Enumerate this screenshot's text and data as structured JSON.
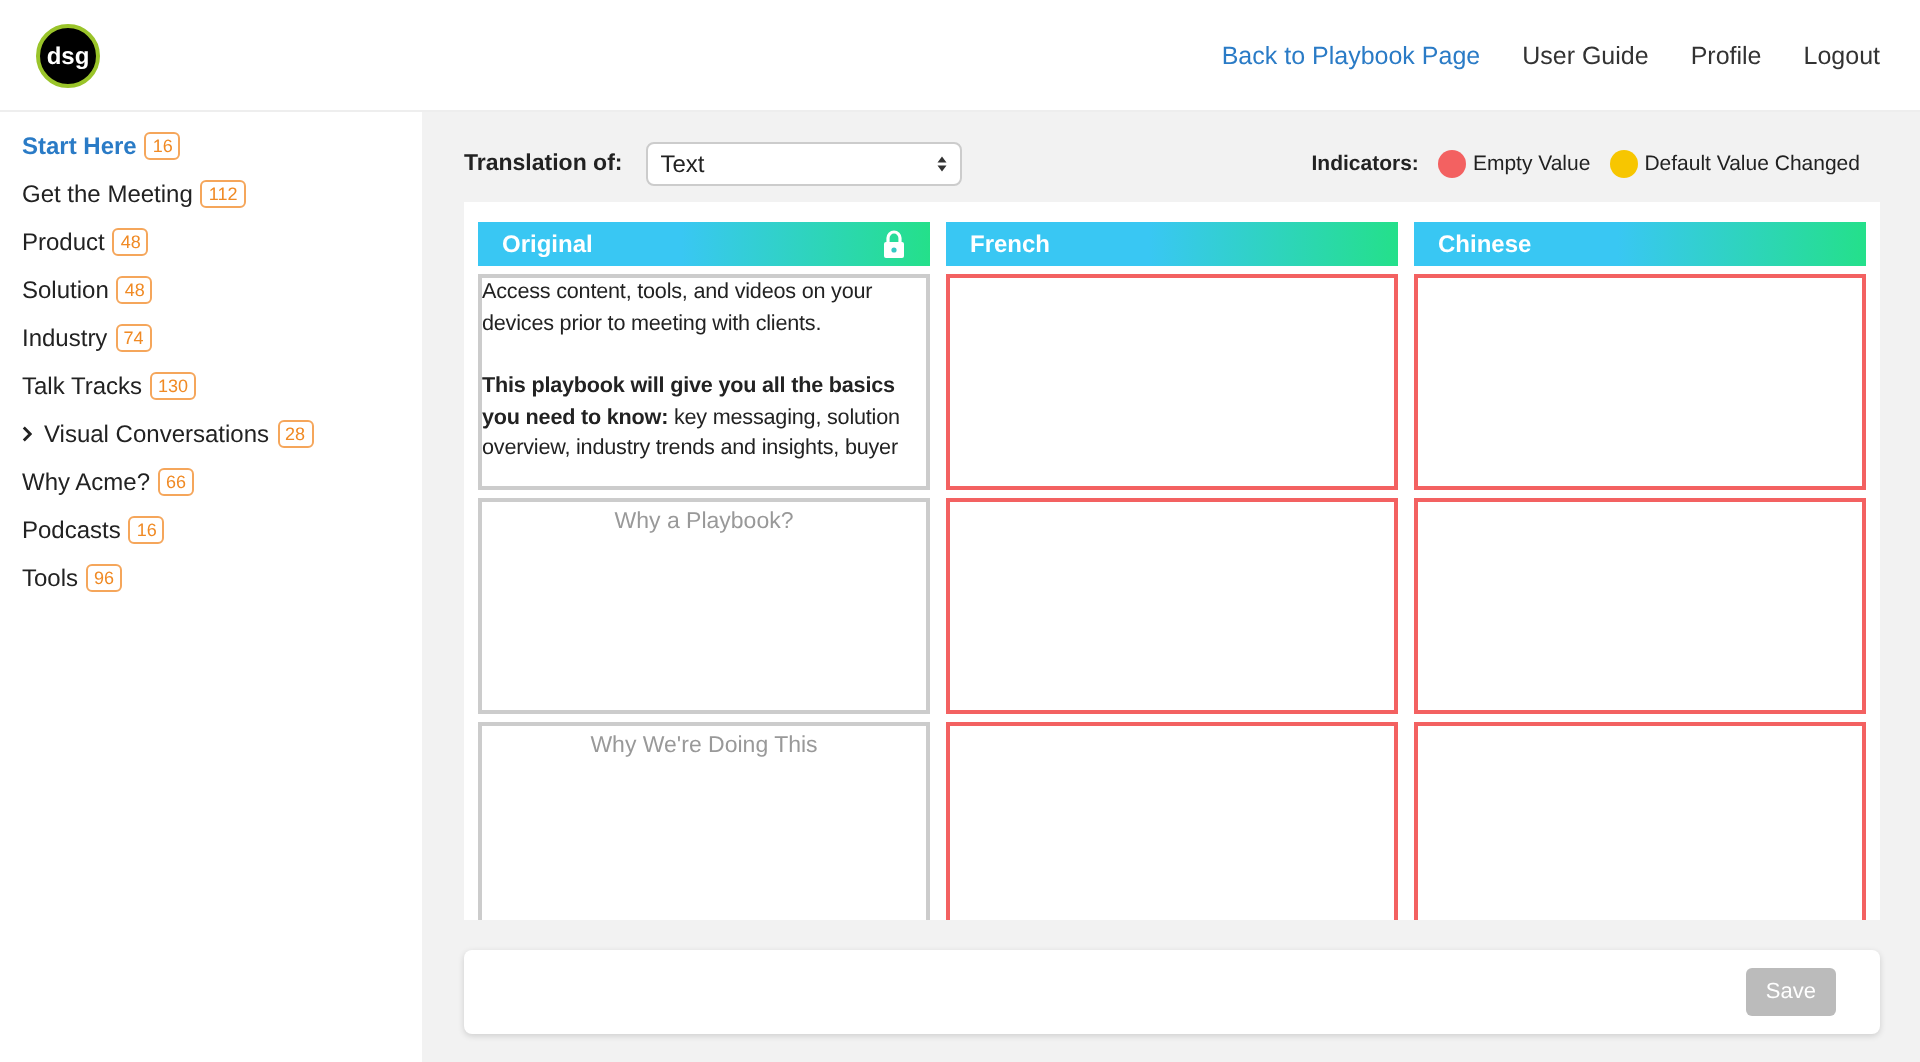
{
  "logo": {
    "text": "dsg"
  },
  "nav": [
    "Back to Playbook Page",
    "User Guide",
    "Profile",
    "Logout"
  ],
  "sidebar": {
    "items": [
      {
        "label": "Start Here",
        "count": "16",
        "selected": true,
        "collapsible": false
      },
      {
        "label": "Get the Meeting",
        "count": "112",
        "selected": false,
        "collapsible": false
      },
      {
        "label": "Product",
        "count": "48",
        "selected": false,
        "collapsible": false
      },
      {
        "label": "Solution",
        "count": "48",
        "selected": false,
        "collapsible": false
      },
      {
        "label": "Industry",
        "count": "74",
        "selected": false,
        "collapsible": false
      },
      {
        "label": "Talk Tracks",
        "count": "130",
        "selected": false,
        "collapsible": false
      },
      {
        "label": "Visual Conversations",
        "count": "28",
        "selected": false,
        "collapsible": true
      },
      {
        "label": "Why Acme?",
        "count": "66",
        "selected": false,
        "collapsible": false
      },
      {
        "label": "Podcasts",
        "count": "16",
        "selected": false,
        "collapsible": false
      },
      {
        "label": "Tools",
        "count": "96",
        "selected": false,
        "collapsible": false
      }
    ]
  },
  "translation_of": {
    "label": "Translation of:",
    "value": "Text"
  },
  "indicators": {
    "label": "Indicators:",
    "items": [
      {
        "label": "Empty Value",
        "color": "#f36161"
      },
      {
        "label": "Default Value Changed",
        "color": "#f7c600"
      }
    ]
  },
  "columns": [
    {
      "title": "Original",
      "locked": true
    },
    {
      "title": "French",
      "locked": false
    },
    {
      "title": "Chinese",
      "locked": false
    }
  ],
  "rows": [
    {
      "original": {
        "paragraphs": [
          "Access content, tools, and videos on your devices prior to meeting with clients.",
          "**This playbook will give you all the basics you need to know:** key messaging, solution overview, industry trends and insights, buyer"
        ]
      },
      "translations": [
        {
          "empty": true
        },
        {
          "empty": true
        }
      ]
    },
    {
      "original": {
        "placeholder": "Why a Playbook?"
      },
      "translations": [
        {
          "empty": true
        },
        {
          "empty": true
        }
      ]
    },
    {
      "original": {
        "placeholder": "Why We're Doing This"
      },
      "translations": [
        {
          "empty": true
        },
        {
          "empty": true
        }
      ]
    }
  ],
  "save_button": {
    "label": "Save",
    "disabled": true
  }
}
